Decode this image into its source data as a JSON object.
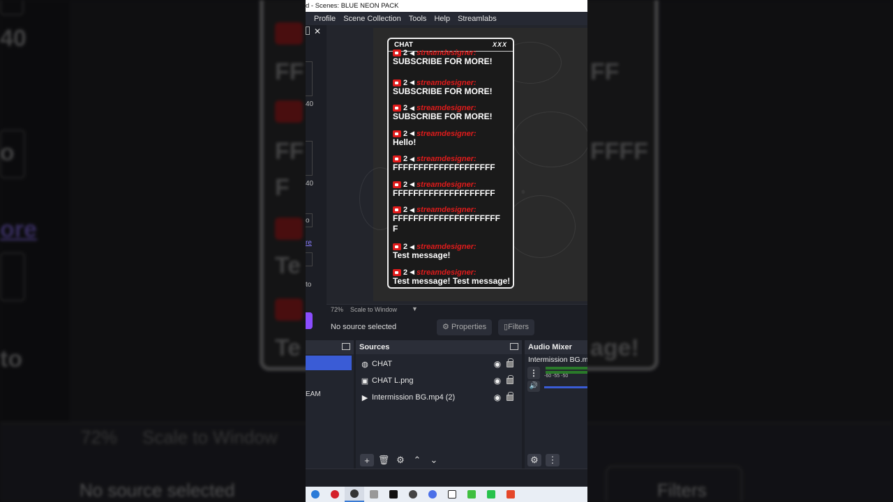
{
  "window": {
    "title": "d - Scenes: BLUE NEON PACK"
  },
  "menu": [
    "Profile",
    "Scene Collection",
    "Tools",
    "Help",
    "Streamlabs"
  ],
  "left_panel": {
    "v1": "40",
    "v2": "40",
    "v3": "o",
    "v4": "re",
    "v5": "to"
  },
  "chat": {
    "title": "CHAT",
    "decoration": "XXX",
    "badge": "2",
    "username": "streamdesigner:",
    "messages": [
      {
        "text": "SUBSCRIBE FOR MORE!"
      },
      {
        "text": "SUBSCRIBE FOR MORE!"
      },
      {
        "text": "SUBSCRIBE FOR MORE!"
      },
      {
        "text": "Hello!"
      },
      {
        "text": "FFFFFFFFFFFFFFFFFFFF"
      },
      {
        "text": "FFFFFFFFFFFFFFFFFFFF"
      },
      {
        "text": "FFFFFFFFFFFFFFFFFFFFF",
        "text2": "F"
      },
      {
        "text": "Test message!"
      },
      {
        "text": "Test message! Test message!"
      }
    ]
  },
  "preview": {
    "zoom": "72%",
    "scale_mode": "Scale to Window"
  },
  "props": {
    "no_source": "No source selected",
    "properties": "Properties",
    "filters": "Filters"
  },
  "scenes": {
    "item": "EAM"
  },
  "sources": {
    "title": "Sources",
    "items": [
      {
        "name": "CHAT",
        "icon": "globe-icon"
      },
      {
        "name": "CHAT L.png",
        "icon": "image-icon"
      },
      {
        "name": "Intermission BG.mp4 (2)",
        "icon": "play-icon"
      }
    ]
  },
  "audio": {
    "title": "Audio Mixer",
    "source": "Intermission BG.m",
    "ticks": "-60  -55  -50"
  },
  "background": {
    "t1": "40",
    "t2": "o",
    "t3": "ore",
    "t4": "to",
    "t5": "FF",
    "t6": "FF",
    "t7": "F",
    "t8": "Te",
    "t9": "Te",
    "t10": "FF",
    "t11": "FFFF",
    "t12": "age!",
    "zoom": "72%",
    "scale": "Scale to Window",
    "no_source": "No source selected",
    "filters": "Filters"
  },
  "colors": {
    "accent": "#3a5cd6",
    "username_red": "#e01b1b",
    "panel": "#22252e"
  }
}
